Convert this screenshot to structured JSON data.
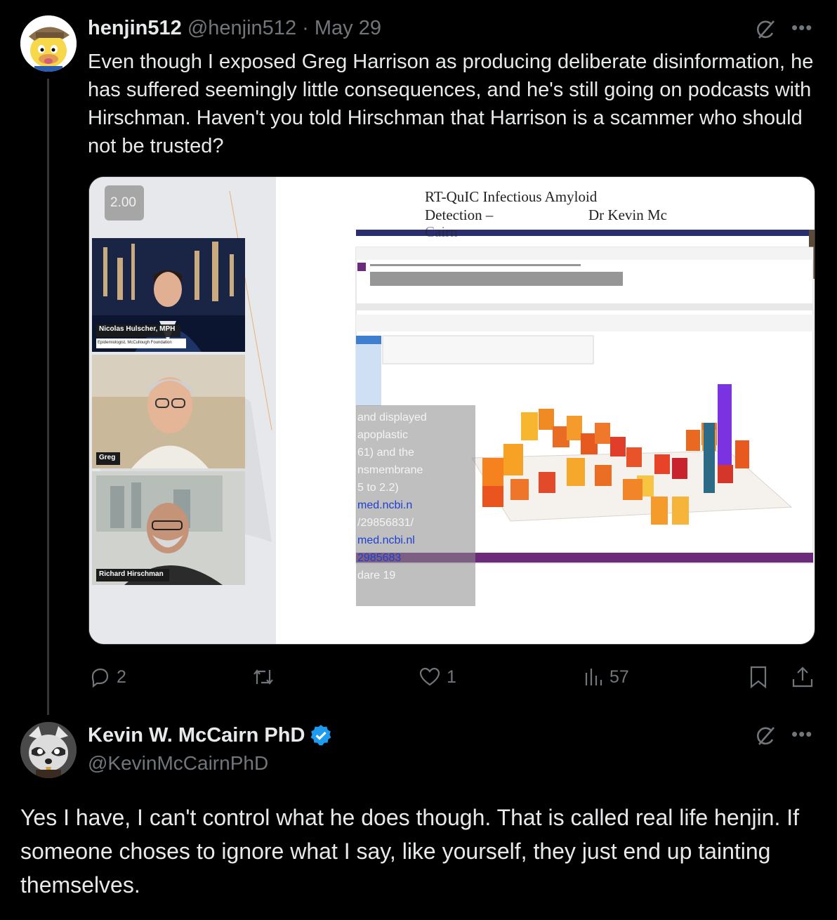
{
  "tweet1": {
    "display_name": "henjin512",
    "handle": "@henjin512",
    "separator": "·",
    "date": "May 29",
    "text": "Even though I exposed Greg Harrison as producing deliberate disinformation, he has suffered seemingly little consequences, and he's still going on podcasts with Hirschman. Haven't you told Hirschman that Harrison is a scammer who should not be trusted?",
    "media": {
      "speed_badge": "2.00",
      "participants": [
        {
          "label": "Nicolas Hulscher, MPH",
          "sublabel": "Epidemiologist, McCullough Foundation"
        },
        {
          "label": "Greg",
          "sublabel": ""
        },
        {
          "label": "Richard Hirschman",
          "sublabel": ""
        }
      ],
      "slide_title_line1": "RT-QuIC Infectious Amyloid",
      "slide_title_line2_left": "Detection –",
      "slide_title_line2_right": "Dr Kevin Mc",
      "slide_title_line3": "Cairn",
      "overlay_fragments": [
        "and displayed",
        "apoplastic",
        "61) and the",
        "nsmembrane",
        "5 to 2.2)",
        "med.ncbi.n",
        "/29856831/",
        "med.ncbi.nl",
        "2985683",
        "dare 19"
      ]
    },
    "stats": {
      "replies": "2",
      "reposts": "",
      "likes": "1",
      "views": "57"
    },
    "icons": [
      "grok-icon",
      "more-icon",
      "reply-icon",
      "repost-icon",
      "like-icon",
      "views-icon",
      "bookmark-icon",
      "share-icon"
    ]
  },
  "tweet2": {
    "display_name": "Kevin W. McCairn PhD",
    "handle": "@KevinMcCairnPhD",
    "verified": true,
    "text": "Yes I have, I can't control what he does though. That is called real life henjin. If someone choses to ignore what I say, like yourself, they just end up tainting themselves."
  },
  "colors": {
    "background": "#000000",
    "text": "#e7e9ea",
    "secondary": "#71767b",
    "verified": "#1d9bf0",
    "divider": "#333639"
  }
}
